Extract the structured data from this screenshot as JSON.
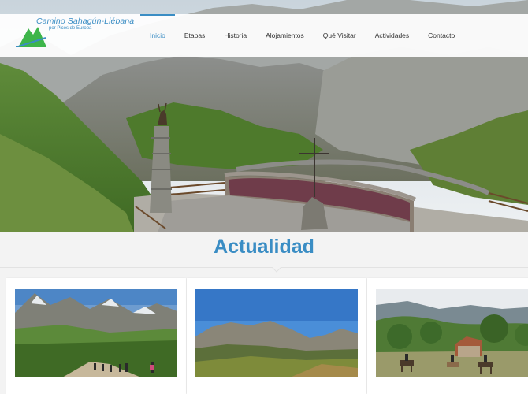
{
  "site": {
    "logo_text": "Camino Sahagún-Liébana",
    "logo_subtitle": "por Picos de Europa"
  },
  "nav": {
    "items": [
      {
        "label": "Inicio",
        "active": true
      },
      {
        "label": "Etapas",
        "active": false
      },
      {
        "label": "Historia",
        "active": false
      },
      {
        "label": "Alojamientos",
        "active": false
      },
      {
        "label": "Qué Visitar",
        "active": false
      },
      {
        "label": "Actividades",
        "active": false
      },
      {
        "label": "Contacto",
        "active": false
      }
    ]
  },
  "section": {
    "title": "Actualidad"
  },
  "colors": {
    "accent": "#3a8dc4",
    "logo_green": "#3db54a"
  },
  "icons": [
    "mountain-logo-icon",
    "chamois-statue-icon",
    "cross-icon"
  ]
}
